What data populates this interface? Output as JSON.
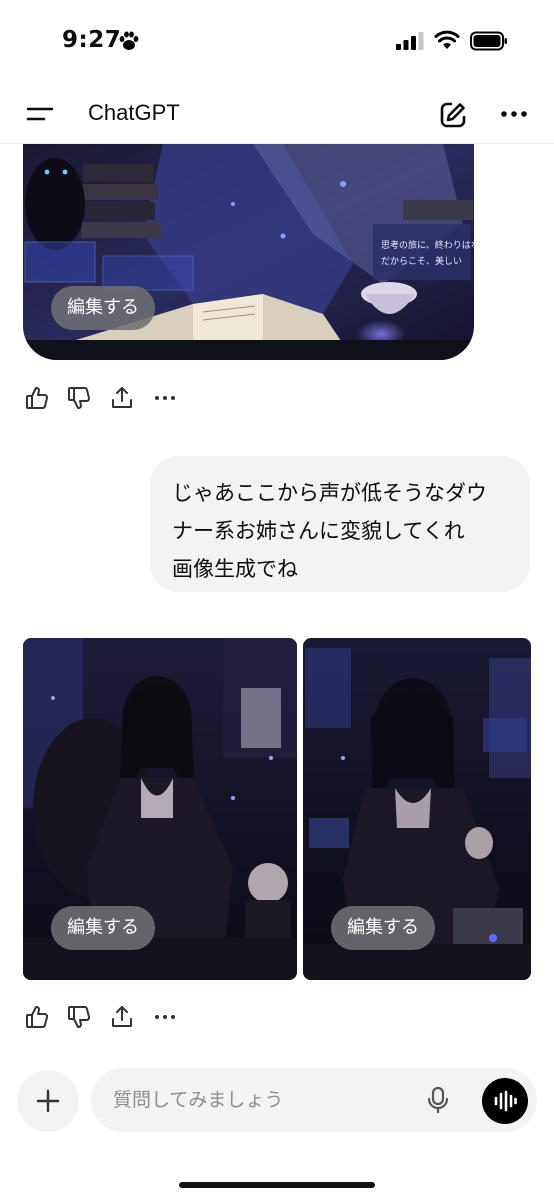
{
  "status_bar": {
    "time": "9:27",
    "icons": [
      "paw-icon",
      "signal-icon",
      "wifi-icon",
      "battery-icon"
    ]
  },
  "header": {
    "title": "ChatGPT",
    "icons": [
      "menu-icon",
      "compose-icon",
      "more-icon"
    ]
  },
  "messages": {
    "first_image": {
      "edit_label": "編集する",
      "overlay_text": [
        "思考の旅に、終わりはない",
        "だからこそ、美しい"
      ]
    },
    "first_actions": [
      "thumbs-up-icon",
      "thumbs-down-icon",
      "share-icon",
      "more-icon"
    ],
    "user_message": {
      "lines": [
        "じゃあここから声が低そうなダウ",
        "ナー系お姉さんに変貌してくれ",
        "画像生成でね"
      ]
    },
    "generated_images": [
      {
        "edit_label": "編集する"
      },
      {
        "edit_label": "編集する"
      }
    ],
    "second_actions": [
      "thumbs-up-icon",
      "thumbs-down-icon",
      "share-icon",
      "more-icon"
    ]
  },
  "composer": {
    "placeholder": "質問してみましょう",
    "icons": [
      "plus-icon",
      "mic-icon",
      "voice-mode-icon"
    ]
  },
  "colors": {
    "bubble": "#f3f3f3",
    "edit_button": "#6e6e73",
    "image_dark": "#12101f",
    "image_accent": "#4a3fb5"
  }
}
